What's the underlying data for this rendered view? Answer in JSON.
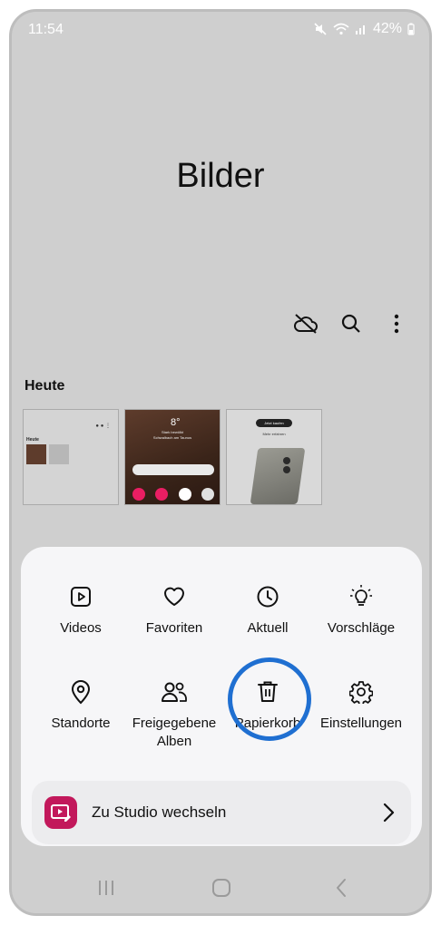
{
  "status": {
    "time": "11:54",
    "battery": "42%"
  },
  "page": {
    "title": "Bilder"
  },
  "section": {
    "title": "Heute"
  },
  "thumbs": {
    "thumb1_title": "Heute",
    "thumb2_temp": "8°",
    "thumb2_line1": "Stark bewölkt",
    "thumb2_line2": "Schwalbach am Taunus",
    "thumb3_button1": "Jetzt kaufen",
    "thumb3_button2": "Mehr erfahren"
  },
  "menu": {
    "items": [
      {
        "label": "Videos",
        "icon": "play-icon"
      },
      {
        "label": "Favoriten",
        "icon": "heart-icon"
      },
      {
        "label": "Aktuell",
        "icon": "clock-icon"
      },
      {
        "label": "Vorschläge",
        "icon": "lightbulb-icon"
      },
      {
        "label": "Standorte",
        "icon": "location-pin-icon"
      },
      {
        "label": "Freigegebene Alben",
        "icon": "people-icon"
      },
      {
        "label": "Papierkorb",
        "icon": "trash-icon"
      },
      {
        "label": "Einstellungen",
        "icon": "gear-icon"
      }
    ],
    "studio_label": "Zu Studio wechseln"
  },
  "colors": {
    "accent_ring": "#1f6fd1",
    "studio_icon": "#c2185b",
    "backdrop": "#cfcfcf",
    "sheet": "#f6f6f8"
  }
}
